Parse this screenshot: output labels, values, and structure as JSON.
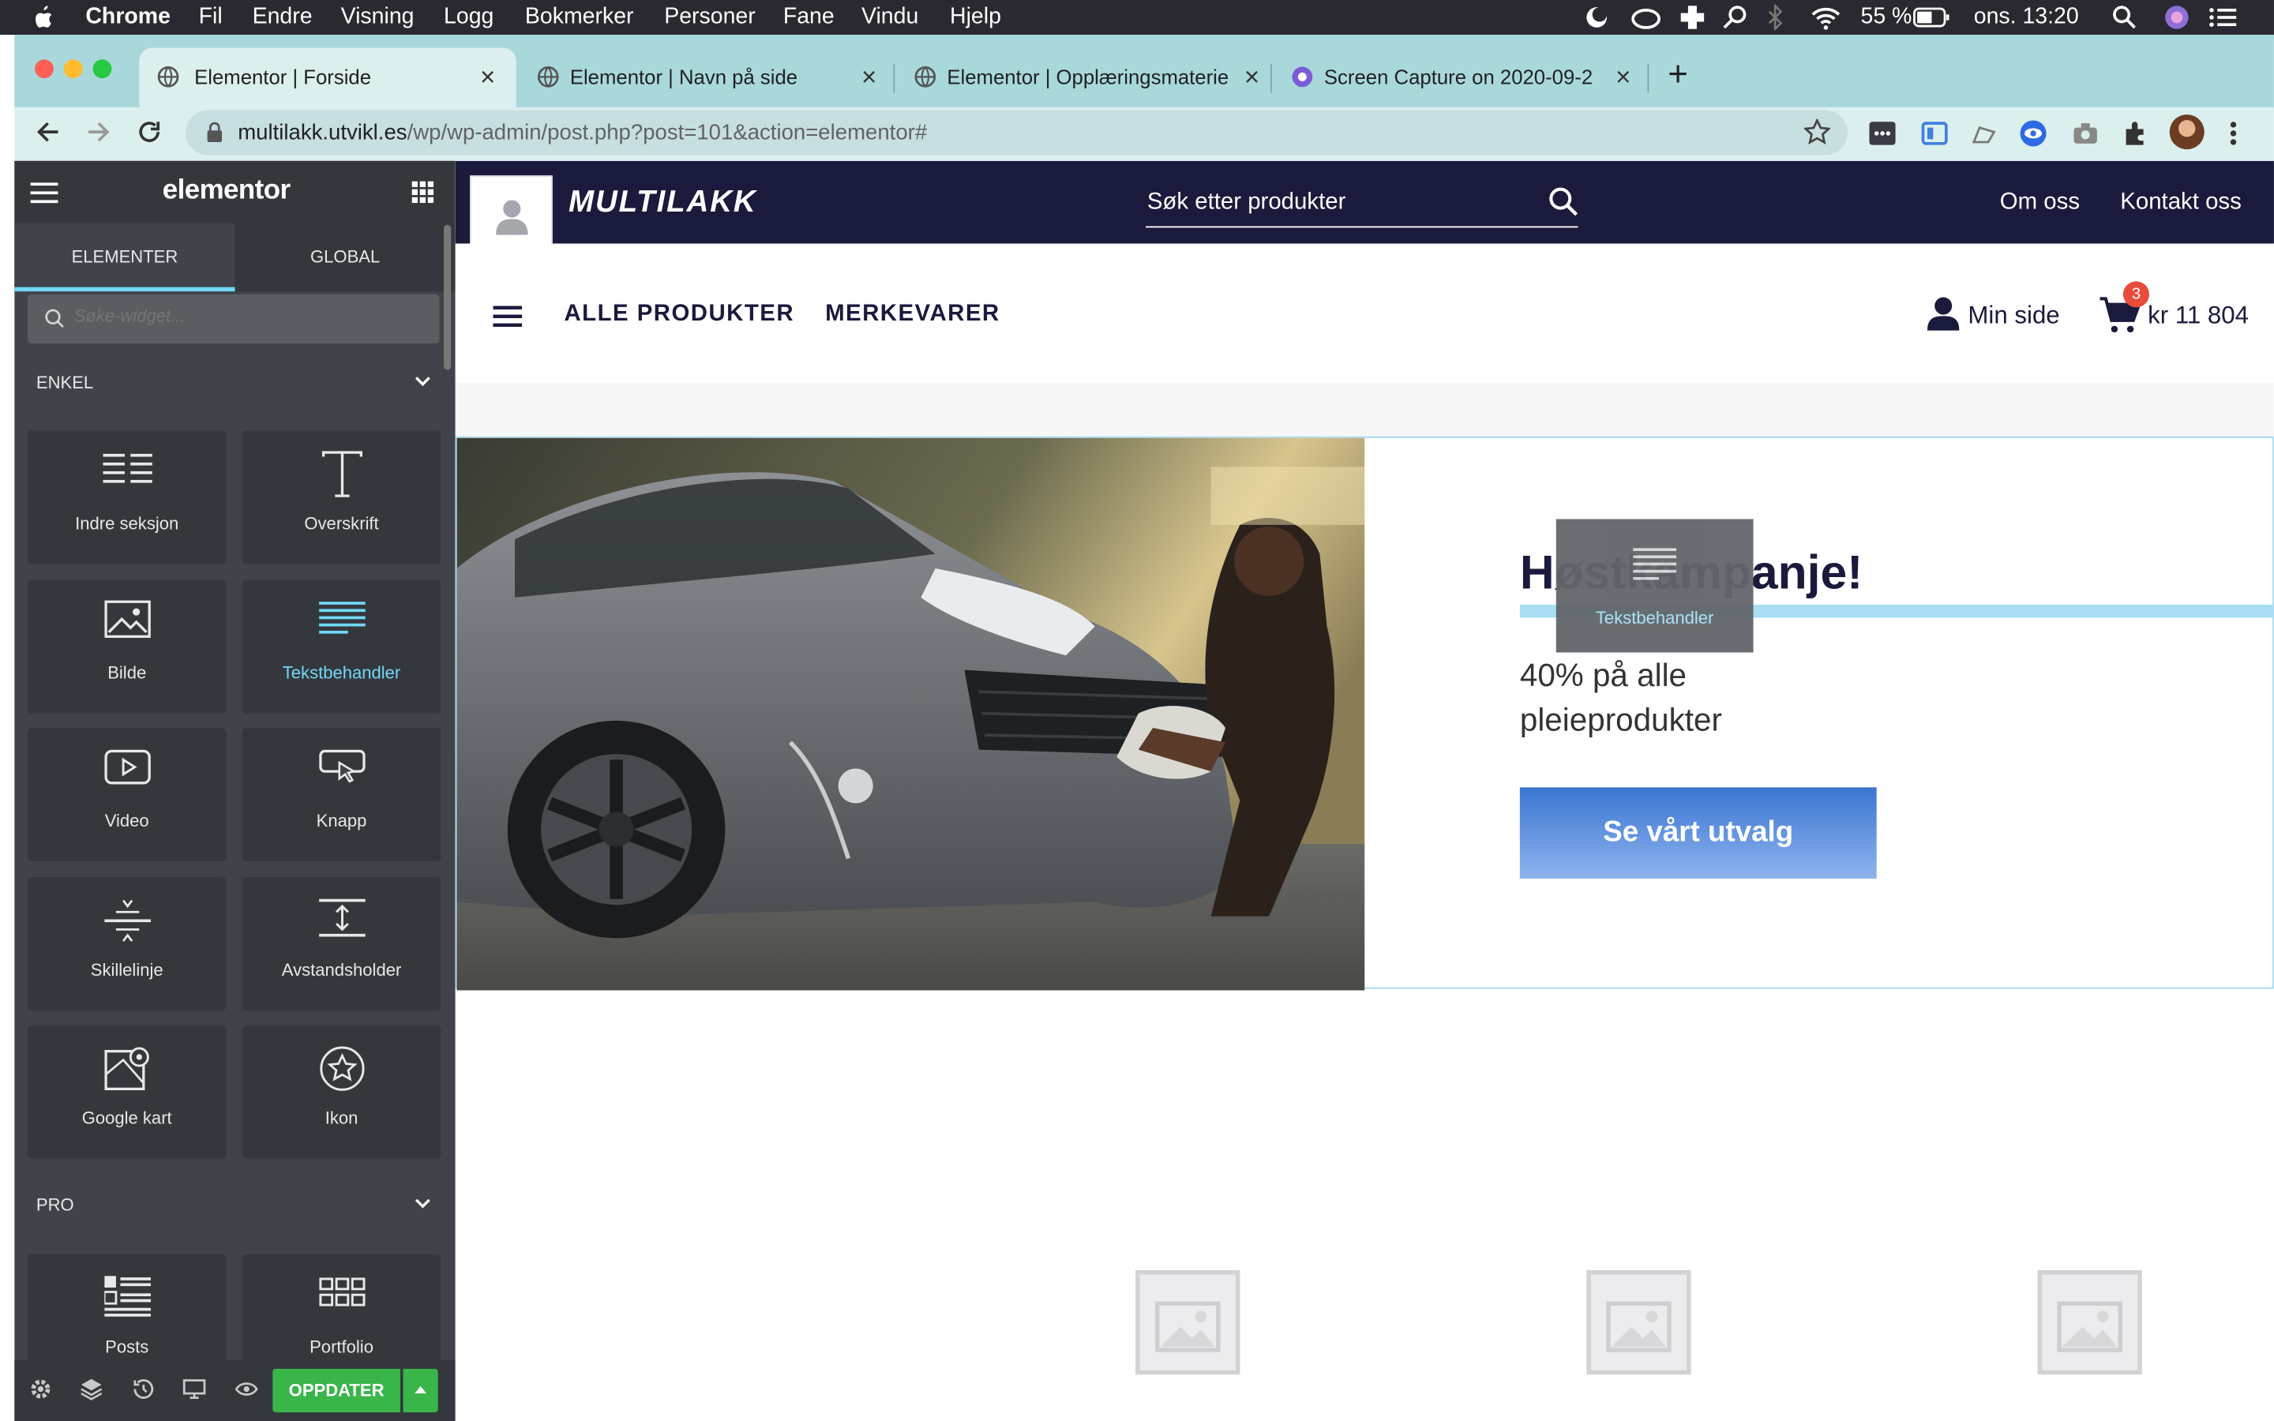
{
  "menubar": {
    "app": "Chrome",
    "items": [
      "Fil",
      "Endre",
      "Visning",
      "Logg",
      "Bokmerker",
      "Personer",
      "Fane",
      "Vindu",
      "Hjelp"
    ],
    "battery": "55 %",
    "clock": "ons. 13:20"
  },
  "tabs": [
    {
      "title": "Elementor | Forside",
      "active": true
    },
    {
      "title": "Elementor | Navn på side",
      "active": false
    },
    {
      "title": "Elementor | Opplæringsmaterie",
      "active": false
    },
    {
      "title": "Screen Capture on 2020-09-2",
      "active": false
    }
  ],
  "address": {
    "host": "multilakk.utvikl.es",
    "path": "/wp/wp-admin/post.php?post=101&action=elementor#"
  },
  "panel": {
    "logo": "elementor",
    "tab_elements": "ELEMENTER",
    "tab_global": "GLOBAL",
    "search_placeholder": "Søke-widget...",
    "section_basic": "ENKEL",
    "section_pro": "PRO",
    "widgets": [
      {
        "label": "Indre seksjon",
        "icon": "inner-section-icon"
      },
      {
        "label": "Overskrift",
        "icon": "heading-icon"
      },
      {
        "label": "Bilde",
        "icon": "image-icon"
      },
      {
        "label": "Tekstbehandler",
        "icon": "text-editor-icon",
        "selected": true
      },
      {
        "label": "Video",
        "icon": "video-icon"
      },
      {
        "label": "Knapp",
        "icon": "button-icon"
      },
      {
        "label": "Skillelinje",
        "icon": "divider-icon"
      },
      {
        "label": "Avstandsholder",
        "icon": "spacer-icon"
      },
      {
        "label": "Google kart",
        "icon": "google-maps-icon"
      },
      {
        "label": "Ikon",
        "icon": "star-icon"
      },
      {
        "label": "Posts",
        "icon": "posts-icon"
      },
      {
        "label": "Portfolio",
        "icon": "portfolio-icon"
      }
    ],
    "update_button": "OPPDATER"
  },
  "site": {
    "brand": "MULTILAKK",
    "search_placeholder": "Søk etter produkter",
    "top_links": [
      "Om oss",
      "Kontakt oss"
    ],
    "nav": [
      "ALLE PRODUKTER",
      "MERKEVARER"
    ],
    "my_page": "Min side",
    "cart_count": "3",
    "cart_total": "kr 11 804",
    "hero": {
      "heading": "Høstkampanje!",
      "subtext_line1": "40% på alle",
      "subtext_line2": "pleieprodukter",
      "cta": "Se vårt utvalg"
    },
    "drag_widget_label": "Tekstbehandler"
  },
  "colors": {
    "site_dark": "#1a1a3c",
    "panel_bg": "#404349",
    "accent_cyan": "#71d7f7",
    "update_green": "#39b54a",
    "cta_blue": "#3b75d2"
  }
}
